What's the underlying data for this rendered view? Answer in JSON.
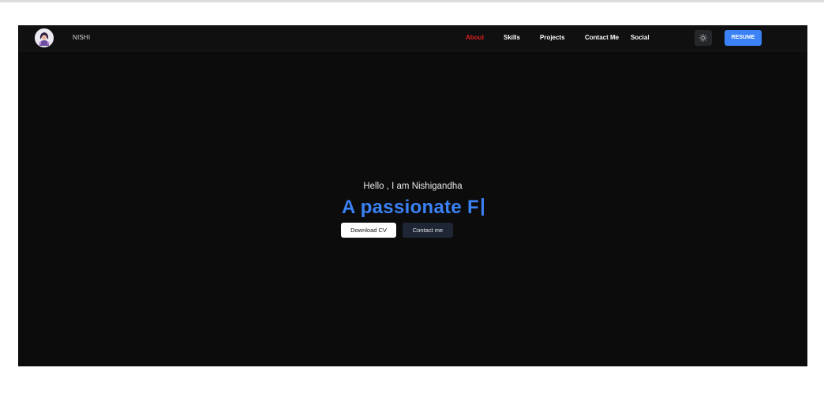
{
  "navbar": {
    "brand": "NISHI",
    "links": [
      {
        "label": "About",
        "active": true
      },
      {
        "label": "Skills",
        "active": false
      },
      {
        "label": "Projects",
        "active": false
      },
      {
        "label": "Contact Me",
        "active": false
      },
      {
        "label": "Social",
        "active": false
      }
    ],
    "theme_toggle_icon": "sun-icon",
    "resume_label": "RESUME"
  },
  "hero": {
    "greeting": "Hello , I am Nishigandha",
    "headline_typed": "A passionate F",
    "download_cv_label": "Download CV",
    "contact_me_label": "Contact me"
  },
  "colors": {
    "accent": "#3b82f6",
    "active_nav": "#e01e1e",
    "background": "#0c0c0d"
  }
}
